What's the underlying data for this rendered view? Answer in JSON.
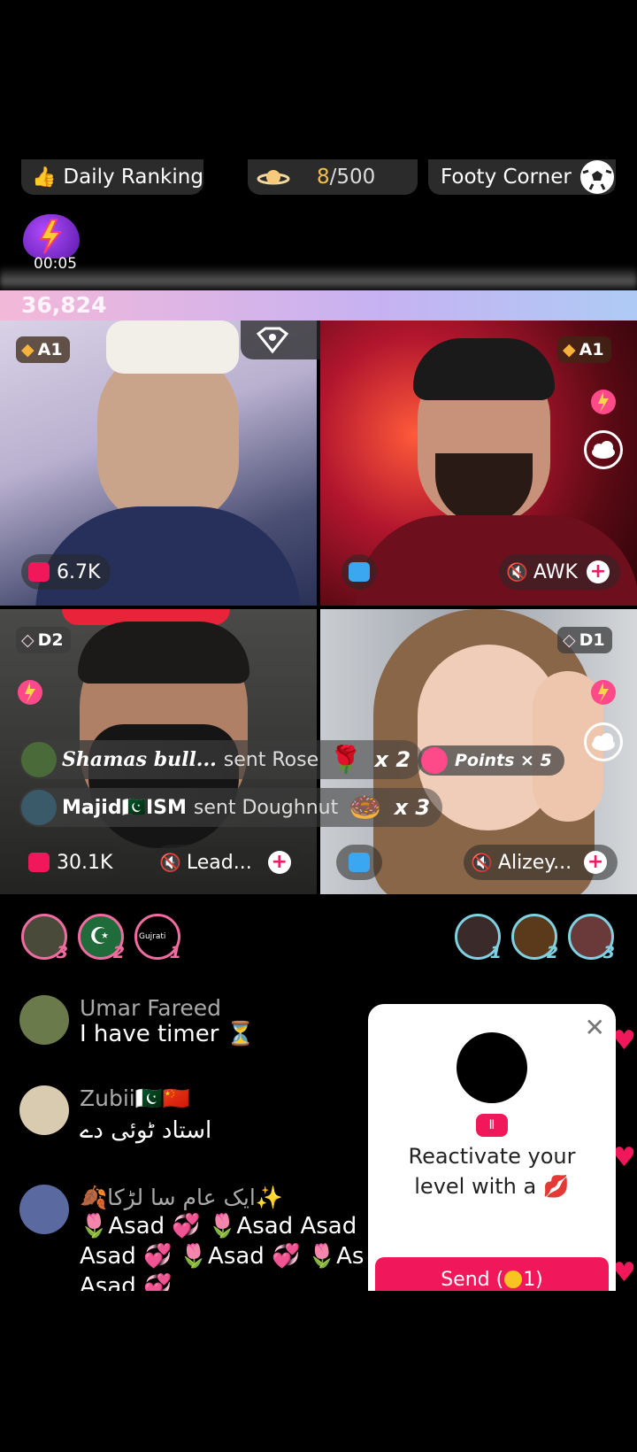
{
  "top_bar": {
    "daily_ranking": "Daily Ranking",
    "progress": "8/500",
    "progress_current": "8",
    "progress_total": "/500",
    "footy_corner": "Footy Corner"
  },
  "timer": "00:05",
  "score": "36,824",
  "battle": {
    "count": "3"
  },
  "tiles": [
    {
      "badge": "A1",
      "count": "6.7K",
      "name": ""
    },
    {
      "badge": "A1",
      "count": "",
      "name": "AWK"
    },
    {
      "badge": "D2",
      "count": "30.1K",
      "name": "Lead..."
    },
    {
      "badge": "D1",
      "count": "",
      "name": "Alizey..."
    }
  ],
  "gift_feed": [
    {
      "user": "Shamas bull...",
      "action": "sent Rose",
      "multiplier": "x 2"
    },
    {
      "user": "Majid🇵🇰ISM",
      "action": "sent Doughnut",
      "multiplier": "x 3"
    }
  ],
  "points": "Points × 5",
  "gifters_left": [
    {
      "num": "3"
    },
    {
      "num": "2"
    },
    {
      "num": "1",
      "label": "Gujrati"
    }
  ],
  "gifters_right": [
    {
      "num": "1"
    },
    {
      "num": "2"
    },
    {
      "num": "3"
    }
  ],
  "chat": [
    {
      "name": "Umar Fareed",
      "message": "I have timer ⏳"
    },
    {
      "name": "Zubii🇵🇰🇨🇳",
      "message": "استاد ٹوئی دے"
    },
    {
      "name": "🍂ایک عام سا لڑکا✨",
      "message": "🌷Asad 💞 🌷Asad Asad Asad 💞 🌷Asad 💞 🌷As Asad 💞"
    }
  ],
  "popup": {
    "line1": "Reactivate your",
    "line2": "level with a 💋",
    "send_label": "Send (",
    "send_coin": "1)"
  },
  "colors": {
    "accent": "#F0185A",
    "gold": "#F2C14E"
  }
}
